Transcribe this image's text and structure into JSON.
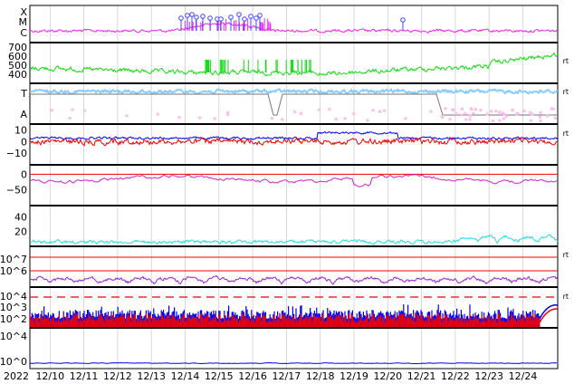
{
  "chart_data": {
    "type": "line",
    "x_ticks": [
      "2022",
      "12/10",
      "12/11",
      "12/12",
      "12/13",
      "12/14",
      "12/15",
      "12/16",
      "12/17",
      "12/18",
      "12/19",
      "12/20",
      "12/21",
      "12/22",
      "12/23",
      "12/24"
    ],
    "corner_marker": "rt",
    "panels": [
      {
        "id": "xmc",
        "ytick_labels": [
          "X",
          "M",
          "C"
        ],
        "series": [
          {
            "color": "#ee22ee"
          },
          {
            "color": "#4444ff"
          }
        ]
      },
      {
        "id": "speed",
        "ytick_labels": [
          "700",
          "600",
          "500",
          "400"
        ],
        "ylim": [
          300,
          750
        ],
        "series": [
          {
            "color": "#11dd11"
          }
        ],
        "rt": true
      },
      {
        "id": "ta",
        "ytick_labels": [
          "T",
          "A"
        ],
        "series": [
          {
            "color": "#88ccff"
          },
          {
            "color": "#ffbbee"
          },
          {
            "color": "#777777"
          }
        ],
        "rt": true
      },
      {
        "id": "bfield",
        "ytick_labels": [
          "10",
          "0",
          "−10"
        ],
        "ylim": [
          -20,
          15
        ],
        "series": [
          {
            "color": "#0000ee"
          },
          {
            "color": "#ee0000"
          }
        ],
        "rt": true
      },
      {
        "id": "dst",
        "ytick_labels": [
          "0",
          "−50"
        ],
        "ylim": [
          -100,
          30
        ],
        "series": [
          {
            "color": "#cc22cc"
          },
          {
            "color": "#ee0000"
          }
        ]
      },
      {
        "id": "kp",
        "ytick_labels": [
          "40",
          "20"
        ],
        "ylim": [
          0,
          55
        ],
        "series": [
          {
            "color": "#22dddd"
          }
        ]
      },
      {
        "id": "density",
        "ytick_labels": [
          "10^7",
          "10^6"
        ],
        "series": [
          {
            "color": "#9922cc"
          },
          {
            "color": "#ee0000"
          }
        ],
        "rt": true
      },
      {
        "id": "proton",
        "ytick_labels": [
          "10^4",
          "10^3",
          "10^2",
          "10^4",
          "10^0"
        ],
        "series": [
          {
            "color": "#0000ee"
          },
          {
            "color": "#ee0000"
          }
        ],
        "rt": true
      }
    ]
  }
}
